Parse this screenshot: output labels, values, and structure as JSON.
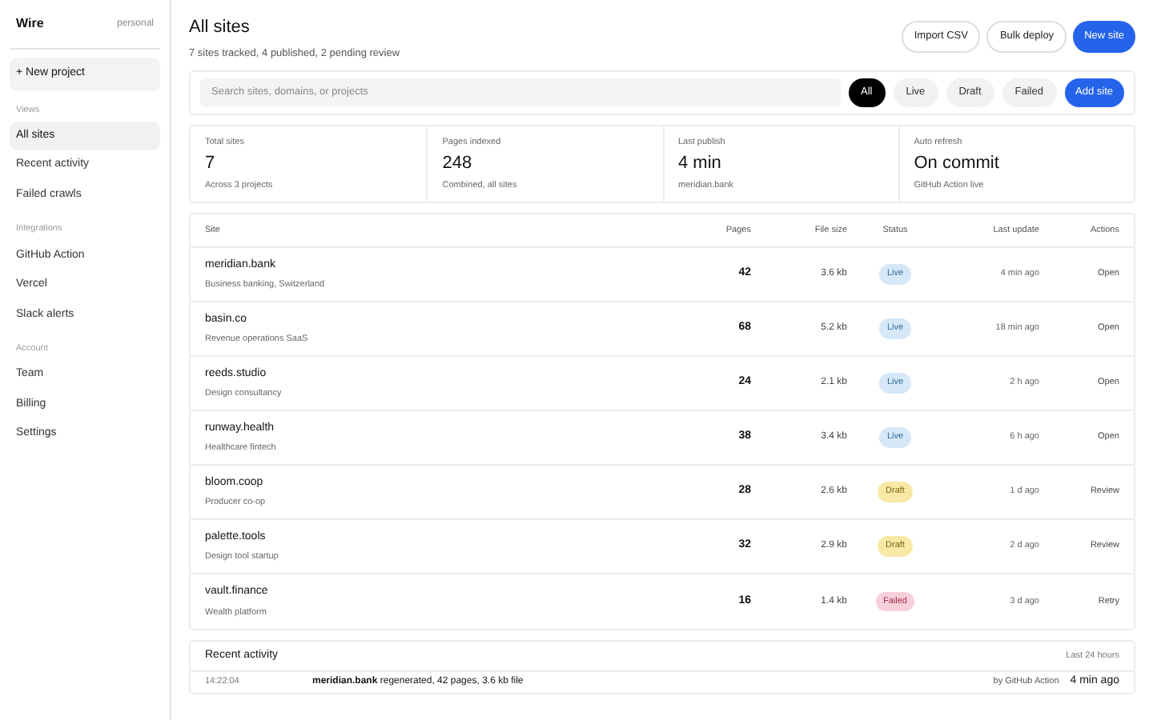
{
  "sidebar": {
    "brand": "Wire",
    "workspace": "personal",
    "new_project": "+ New project",
    "sections": [
      {
        "heading": "Views",
        "items": [
          {
            "label": "All sites",
            "selected": true
          },
          {
            "label": "Recent activity",
            "selected": false
          },
          {
            "label": "Failed crawls",
            "selected": false
          }
        ]
      },
      {
        "heading": "Integrations",
        "items": [
          {
            "label": "GitHub Action",
            "selected": false
          },
          {
            "label": "Vercel",
            "selected": false
          },
          {
            "label": "Slack alerts",
            "selected": false
          }
        ]
      },
      {
        "heading": "Account",
        "items": [
          {
            "label": "Team",
            "selected": false
          },
          {
            "label": "Billing",
            "selected": false
          },
          {
            "label": "Settings",
            "selected": false
          }
        ]
      }
    ]
  },
  "header": {
    "title": "All sites",
    "subtitle": "7 sites tracked, 4 published, 2 pending review",
    "buttons": [
      {
        "label": "Import CSV",
        "kind": "outline"
      },
      {
        "label": "Bulk deploy",
        "kind": "outline"
      },
      {
        "label": "New site",
        "kind": "primary"
      }
    ]
  },
  "filter_bar": {
    "search": {
      "placeholder": "Search sites, domains, or projects"
    },
    "filters": [
      {
        "label": "All",
        "selected": true
      },
      {
        "label": "Live",
        "selected": false
      },
      {
        "label": "Draft",
        "selected": false
      },
      {
        "label": "Failed",
        "selected": false
      }
    ],
    "add_button": "Add site"
  },
  "stats": [
    {
      "label": "Total sites",
      "value": "7",
      "note": "Across 3 projects"
    },
    {
      "label": "Pages indexed",
      "value": "248",
      "note": "Combined, all sites"
    },
    {
      "label": "Last publish",
      "value": "4 min",
      "note": "meridian.bank"
    },
    {
      "label": "Auto refresh",
      "value": "On commit",
      "note": "GitHub Action live"
    }
  ],
  "table": {
    "columns": [
      "Site",
      "Pages",
      "File size",
      "Status",
      "Last update",
      "Actions"
    ],
    "rows": [
      {
        "site": "meridian.bank",
        "description": "Business banking, Switzerland",
        "pages": "42",
        "size": "3.6 kb",
        "status": "Live",
        "kind": "live",
        "updated": "4 min ago",
        "action": "Open"
      },
      {
        "site": "basin.co",
        "description": "Revenue operations SaaS",
        "pages": "68",
        "size": "5.2 kb",
        "status": "Live",
        "kind": "live",
        "updated": "18 min ago",
        "action": "Open"
      },
      {
        "site": "reeds.studio",
        "description": "Design consultancy",
        "pages": "24",
        "size": "2.1 kb",
        "status": "Live",
        "kind": "live",
        "updated": "2 h ago",
        "action": "Open"
      },
      {
        "site": "runway.health",
        "description": "Healthcare fintech",
        "pages": "38",
        "size": "3.4 kb",
        "status": "Live",
        "kind": "live",
        "updated": "6 h ago",
        "action": "Open"
      },
      {
        "site": "bloom.coop",
        "description": "Producer co-op",
        "pages": "28",
        "size": "2.6 kb",
        "status": "Draft",
        "kind": "draft",
        "updated": "1 d ago",
        "action": "Review"
      },
      {
        "site": "palette.tools",
        "description": "Design tool startup",
        "pages": "32",
        "size": "2.9 kb",
        "status": "Draft",
        "kind": "draft",
        "updated": "2 d ago",
        "action": "Review"
      },
      {
        "site": "vault.finance",
        "description": "Wealth platform",
        "pages": "16",
        "size": "1.4 kb",
        "status": "Failed",
        "kind": "failed",
        "updated": "3 d ago",
        "action": "Retry"
      }
    ]
  },
  "activity": {
    "title": "Recent activity",
    "range": "Last 24 hours",
    "items": [
      {
        "time": "14:22:04",
        "text": "**meridian.bank** regenerated, 42 pages, 3.6 kb file",
        "source": "by GitHub Action",
        "ago": "4 min ago"
      }
    ]
  }
}
